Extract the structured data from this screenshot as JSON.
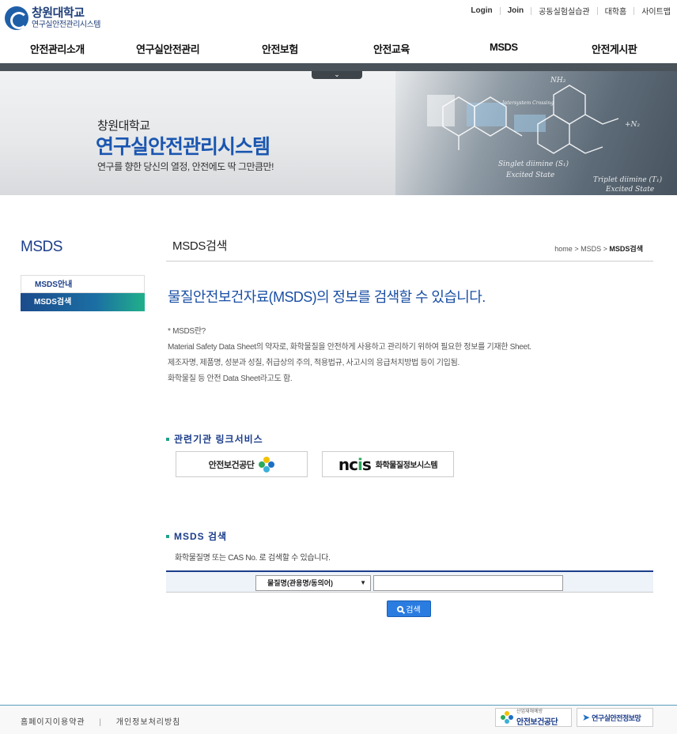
{
  "header": {
    "logo_main": "창원대학교",
    "logo_sub": "연구실안전관리시스템",
    "util_links": [
      "Login",
      "Join",
      "공동실험실습관",
      "대학홈",
      "사이트맵"
    ],
    "gnb": [
      "안전관리소개",
      "연구실안전관리",
      "안전보험",
      "안전교육",
      "MSDS",
      "안전게시판"
    ]
  },
  "visual": {
    "tab_icon": "chevron-down-icon",
    "sub": "창원대학교",
    "title": "연구실안전관리시스템",
    "slogan": "연구를 향한 당신의 열정, 안전에도 딱 그만큼만!"
  },
  "lnb": {
    "title": "MSDS",
    "items": [
      "MSDS안내",
      "MSDS검색"
    ],
    "active_index": 1
  },
  "content": {
    "title": "MSDS검색",
    "breadcrumb": {
      "home": "home",
      "sep": ">",
      "level1": "MSDS",
      "current": "MSDS검색"
    },
    "lead": "물질안전보건자료(MSDS)의 정보를 검색할 수 있습니다.",
    "desc": [
      "* MSDS란?",
      "Material Safety Data Sheet의 약자로, 화학물질을 안전하게 사용하고 관리하기 위하여 필요한 정보를 기재한 Sheet.",
      "제조자명, 제품명, 성분과 성질, 취급상의 주의, 적용법규, 사고시의 응급처치방법 등이 기입됨.",
      "화학물질 등 안전 Data Sheet라고도 함."
    ]
  },
  "links_section": {
    "title": "관련기관 링크서비스",
    "kosha_label": "안전보건공단",
    "ncis_logo": "ncis",
    "ncis_label": "화학물질정보시스템"
  },
  "search_section": {
    "title": "MSDS 검색",
    "hint": "화학물질명 또는 CAS No. 로 검색할 수 있습니다.",
    "select_value": "물질명(관용명/동의어)",
    "input_value": "",
    "button_label": "검색"
  },
  "footer": {
    "links": [
      "홈페이지이용약관",
      "개인정보처리방침"
    ],
    "banner1_small": "산업재해예방",
    "banner1": "안전보건공단",
    "banner2": "연구실안전정보망"
  },
  "colors": {
    "brand_navy": "#1b3d8a",
    "accent_blue": "#1a56b0",
    "accent_green": "#21a08a",
    "button_blue": "#2b7ce0"
  }
}
